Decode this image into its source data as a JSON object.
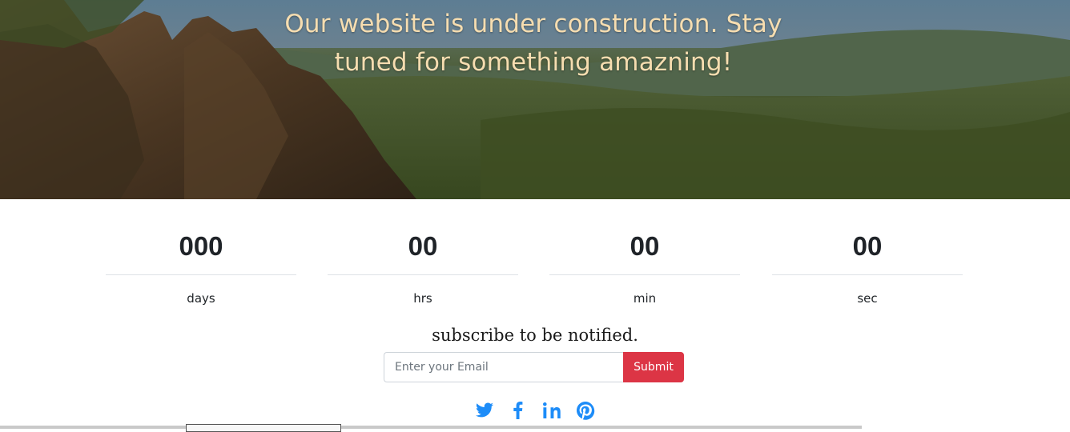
{
  "hero": {
    "title": "Our website is under construction. Stay tuned for something amazning!"
  },
  "countdown": [
    {
      "value": "000",
      "unit": "days"
    },
    {
      "value": "00",
      "unit": "hrs"
    },
    {
      "value": "00",
      "unit": "min"
    },
    {
      "value": "00",
      "unit": "sec"
    }
  ],
  "subscribe": {
    "title": "subscribe to be notified.",
    "email_placeholder": "Enter your Email",
    "email_value": "",
    "submit_label": "Submit"
  },
  "socials": [
    {
      "icon": "twitter-icon"
    },
    {
      "icon": "facebook-icon"
    },
    {
      "icon": "linkedin-icon"
    },
    {
      "icon": "pinterest-icon"
    }
  ],
  "colors": {
    "title_text": "#f6ddb0",
    "submit_bg": "#dc3545",
    "social_icon": "#1d8cf8"
  }
}
